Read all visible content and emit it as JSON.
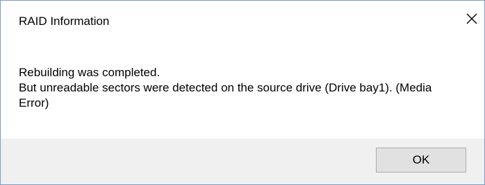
{
  "dialog": {
    "title": "RAID Information",
    "close_icon": "close-icon"
  },
  "message": {
    "line1": "Rebuilding was completed.",
    "line2": "But unreadable sectors were detected on the source drive (Drive bay1). (Media Error)"
  },
  "footer": {
    "ok_label": "OK"
  },
  "colors": {
    "window_border": "#7a9cc6",
    "footer_bg": "#f0f0f0",
    "button_bg": "#e1e1e1",
    "button_border": "#adadad"
  }
}
